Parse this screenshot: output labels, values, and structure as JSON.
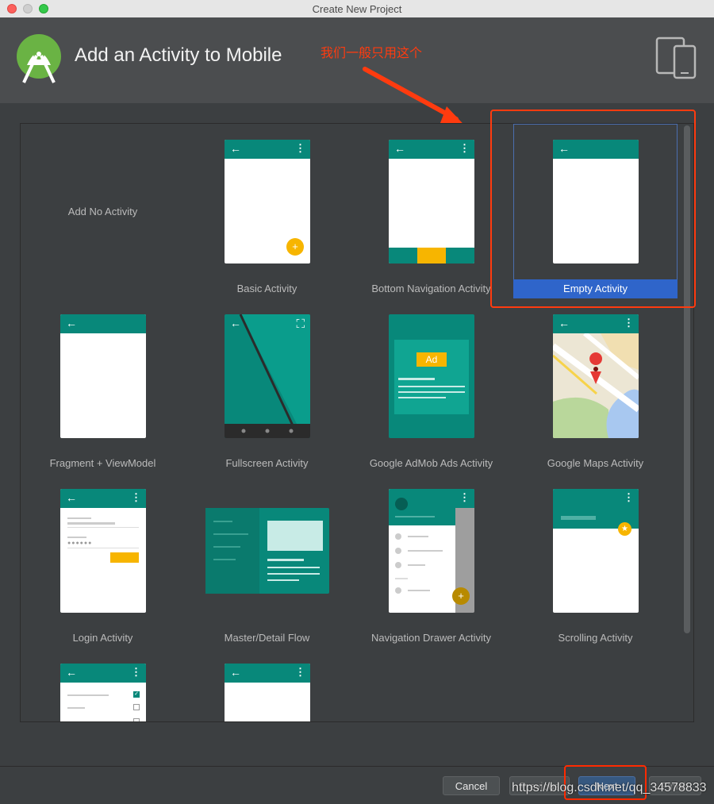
{
  "window": {
    "title": "Create New Project"
  },
  "header": {
    "title": "Add an Activity to Mobile"
  },
  "annotation": {
    "text": "我们一般只用这个"
  },
  "templates": [
    {
      "label": "Add No Activity"
    },
    {
      "label": "Basic Activity"
    },
    {
      "label": "Bottom Navigation Activity"
    },
    {
      "label": "Empty Activity",
      "selected": true
    },
    {
      "label": "Fragment + ViewModel"
    },
    {
      "label": "Fullscreen Activity"
    },
    {
      "label": "Google AdMob Ads Activity",
      "badge": "Ad"
    },
    {
      "label": "Google Maps Activity"
    },
    {
      "label": "Login Activity"
    },
    {
      "label": "Master/Detail Flow"
    },
    {
      "label": "Navigation Drawer Activity"
    },
    {
      "label": "Scrolling Activity"
    },
    {
      "label": ""
    },
    {
      "label": ""
    }
  ],
  "footer": {
    "cancel": "Cancel",
    "previous": "Previous",
    "next": "Next",
    "finish": "Finish"
  },
  "watermark": "https://blog.csdn.net/qq_34578833",
  "colors": {
    "teal": "#08887a",
    "accent": "#f7b500",
    "selection": "#2f65ca",
    "annotation": "#ff3b0f"
  }
}
